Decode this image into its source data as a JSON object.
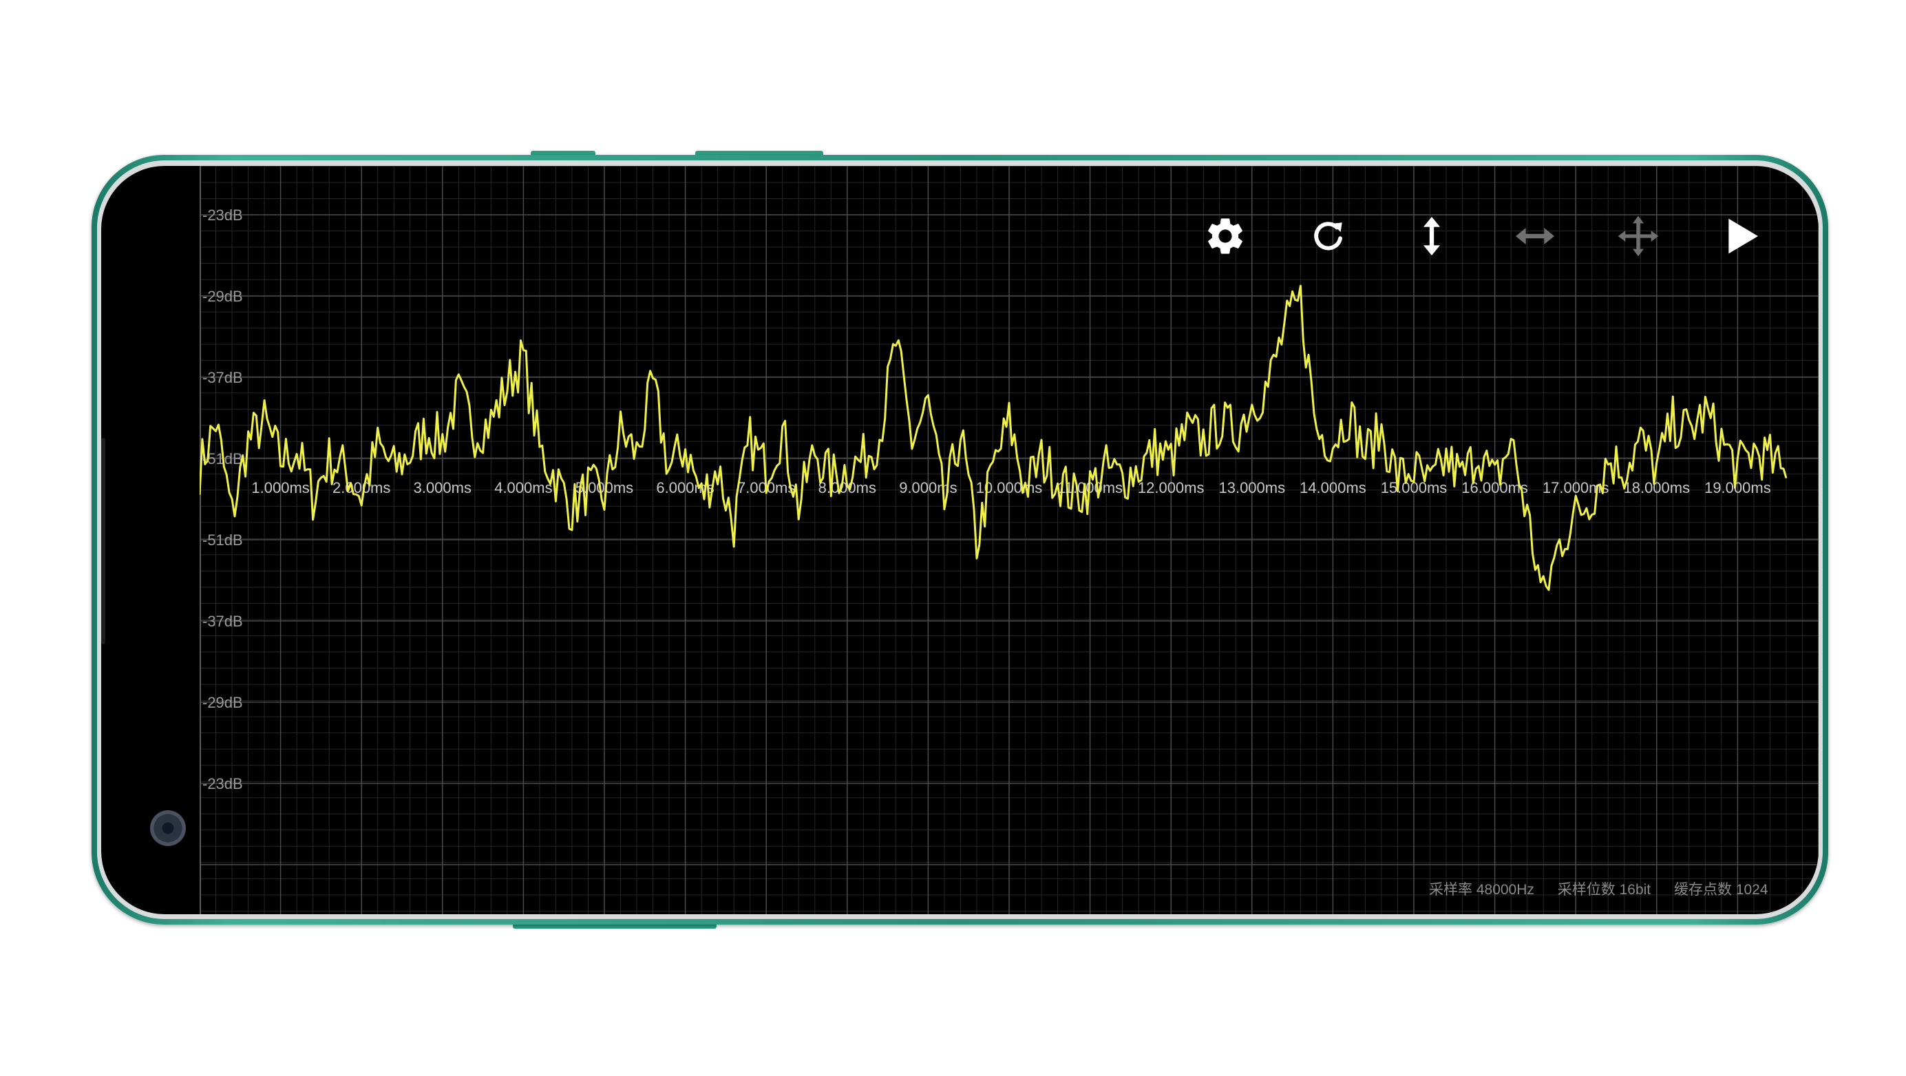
{
  "app": {
    "toolbar": {
      "icons": [
        {
          "name": "settings-gear-icon",
          "state": "active",
          "color": "#ffffff"
        },
        {
          "name": "refresh-icon",
          "state": "active",
          "color": "#ffffff"
        },
        {
          "name": "vertical-scale-icon",
          "state": "active",
          "color": "#ffffff"
        },
        {
          "name": "horizontal-scale-icon",
          "state": "disabled",
          "color": "#707070"
        },
        {
          "name": "move-pan-icon",
          "state": "disabled",
          "color": "#707070"
        },
        {
          "name": "play-icon",
          "state": "active",
          "color": "#ffffff"
        }
      ]
    },
    "status": {
      "sample_rate": "采样率 48000Hz",
      "bit_depth": "采样位数 16bit",
      "buffer_points": "缓存点数 1024"
    }
  },
  "colors": {
    "waveform": "#f0f04a",
    "grid_major": "#4a4a4a",
    "grid_minor": "#262626",
    "label": "#9a9a9a",
    "screen_bg": "#000000"
  },
  "chart_data": {
    "type": "line",
    "title": "",
    "xlabel": "",
    "ylabel": "",
    "grid": true,
    "y_tick_labels": [
      "-23dB",
      "-29dB",
      "-37dB",
      "-51dB",
      "-51dB",
      "-37dB",
      "-29dB",
      "-23dB"
    ],
    "x_tick_labels": [
      "1.000ms",
      "2.000ms",
      "3.000ms",
      "4.000ms",
      "5.000ms",
      "6.000ms",
      "7.000ms",
      "8.000ms",
      "9.000ms",
      "10.000ms",
      "11.000ms",
      "12.000ms",
      "13.000ms",
      "14.000ms",
      "15.000ms",
      "16.000ms",
      "17.000ms",
      "18.000ms",
      "19.000ms"
    ],
    "xlim_ms": [
      0,
      19.6
    ],
    "ylim": [
      -1,
      1
    ],
    "series": [
      {
        "x_ms": [
          0,
          0.2,
          0.4,
          0.6,
          0.8,
          1.0,
          1.2,
          1.4,
          1.6,
          1.8,
          2.0,
          2.2,
          2.4,
          2.6,
          2.8,
          3.0,
          3.2,
          3.4,
          3.6,
          3.8,
          4.0,
          4.2,
          4.4,
          4.6,
          4.8,
          5.0,
          5.2,
          5.4,
          5.6,
          5.8,
          6.0,
          6.2,
          6.4,
          6.6,
          6.8,
          7.0,
          7.2,
          7.4,
          7.6,
          7.8,
          8.0,
          8.2,
          8.4,
          8.6,
          8.8,
          9.0,
          9.2,
          9.4,
          9.6,
          9.8,
          10.0,
          10.2,
          10.4,
          10.6,
          10.8,
          11.0,
          11.2,
          11.4,
          11.6,
          11.8,
          12.0,
          12.2,
          12.4,
          12.6,
          12.8,
          13.0,
          13.2,
          13.4,
          13.6,
          13.8,
          14.0,
          14.2,
          14.4,
          14.6,
          14.8,
          15.0,
          15.2,
          15.4,
          15.6,
          15.8,
          16.0,
          16.2,
          16.4,
          16.6,
          16.8,
          17.0,
          17.2,
          17.4,
          17.6,
          17.8,
          18.0,
          18.2,
          18.4,
          18.6,
          18.8,
          19.0,
          19.2,
          19.4,
          19.6
        ],
        "y": [
          0.1,
          0.35,
          -0.15,
          0.25,
          0.35,
          0.15,
          0.2,
          -0.05,
          0.15,
          0.1,
          -0.05,
          0.22,
          0.1,
          0.18,
          0.3,
          0.25,
          0.5,
          0.3,
          0.35,
          0.55,
          0.7,
          0.2,
          0.05,
          -0.12,
          0.0,
          -0.05,
          0.3,
          0.18,
          0.55,
          0.1,
          0.22,
          -0.05,
          0.1,
          -0.2,
          0.25,
          0.1,
          0.3,
          -0.1,
          0.2,
          0.05,
          0.1,
          0.15,
          0.28,
          0.78,
          0.25,
          0.45,
          -0.1,
          0.3,
          -0.3,
          0.1,
          0.35,
          0.0,
          0.15,
          0.05,
          -0.05,
          0.0,
          0.1,
          0.05,
          0.1,
          0.2,
          0.15,
          0.3,
          0.25,
          0.35,
          0.3,
          0.45,
          0.55,
          0.85,
          1.0,
          0.3,
          0.25,
          0.4,
          0.18,
          0.3,
          0.05,
          0.1,
          0.0,
          0.15,
          0.05,
          0.2,
          0.02,
          0.25,
          -0.15,
          -0.6,
          -0.3,
          -0.15,
          -0.05,
          0.15,
          0.1,
          0.25,
          0.1,
          0.35,
          0.3,
          0.4,
          0.25,
          0.1,
          0.2,
          0.15,
          0.05
        ]
      }
    ]
  }
}
